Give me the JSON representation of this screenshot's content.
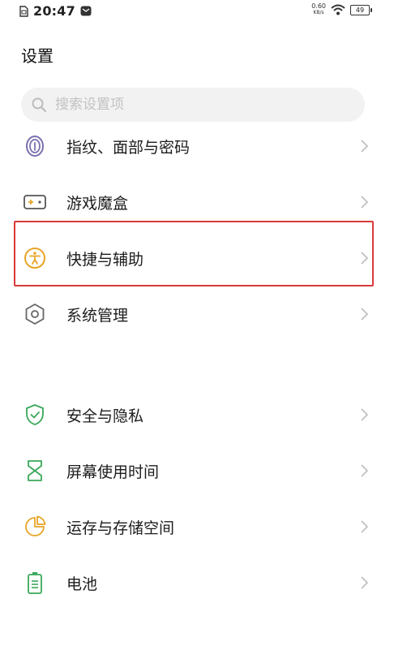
{
  "status_bar": {
    "time": "20:47",
    "net_speed_value": "0.60",
    "net_speed_unit": "KB/s",
    "battery_level": "49"
  },
  "page": {
    "title": "设置"
  },
  "search": {
    "placeholder": "搜索设置项"
  },
  "settings": {
    "items": [
      {
        "label": "指纹、面部与密码",
        "icon": "fingerprint-icon"
      },
      {
        "label": "游戏魔盒",
        "icon": "gamepad-icon"
      },
      {
        "label": "快捷与辅助",
        "icon": "accessibility-icon"
      },
      {
        "label": "系统管理",
        "icon": "hexagon-settings-icon"
      },
      {
        "label": "安全与隐私",
        "icon": "shield-check-icon"
      },
      {
        "label": "屏幕使用时间",
        "icon": "hourglass-icon"
      },
      {
        "label": "运存与存储空间",
        "icon": "pie-chart-icon"
      },
      {
        "label": "电池",
        "icon": "battery-icon"
      }
    ]
  },
  "colors": {
    "highlight": "#d93a3a",
    "icon_purple": "#7b6fae",
    "icon_orange": "#e8a427",
    "icon_gray": "#666666",
    "icon_green": "#3aa85a",
    "chevron": "#bdbdbd"
  }
}
